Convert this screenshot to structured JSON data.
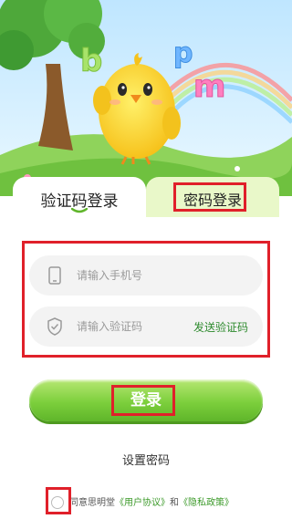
{
  "tabs": {
    "sms_login": "验证码登录",
    "password_login": "密码登录"
  },
  "form": {
    "phone_placeholder": "请输入手机号",
    "code_placeholder": "请输入验证码",
    "send_code": "发送验证码"
  },
  "login_button": "登录",
  "set_password": "设置密码",
  "agreement": {
    "prefix": "同意思明堂",
    "user_agreement": "《用户协议》",
    "and": "和",
    "privacy_policy": "《隐私政策》"
  },
  "hero": {
    "letters": [
      "b",
      "p",
      "m"
    ]
  },
  "colors": {
    "accent_green": "#7ccf3c",
    "highlight_red": "#e0202a",
    "link_green": "#3c9a2a"
  }
}
